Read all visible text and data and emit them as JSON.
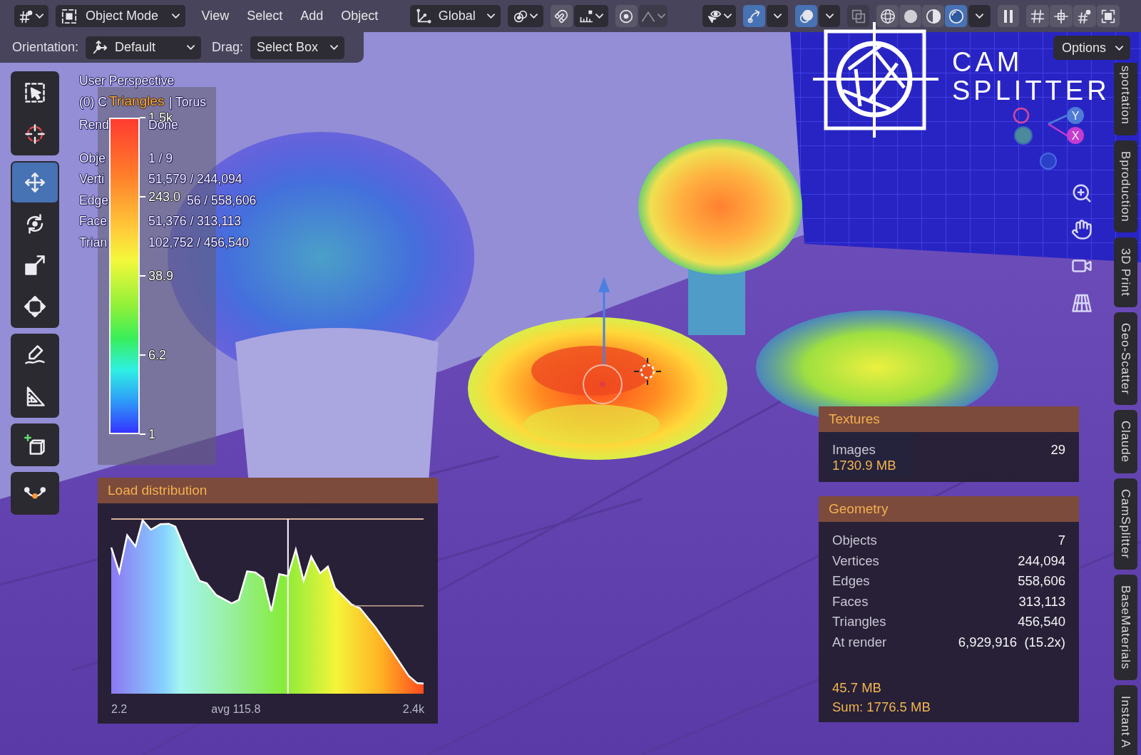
{
  "header": {
    "mode": {
      "label": "Object Mode"
    },
    "menus": [
      {
        "label": "View"
      },
      {
        "label": "Select"
      },
      {
        "label": "Add"
      },
      {
        "label": "Object"
      }
    ],
    "transform_orientation": {
      "label": "Global"
    },
    "snapping": {
      "on": false
    },
    "proportional_editing": {
      "on": false
    },
    "gizmos": {
      "on": true
    },
    "overlays": {
      "on": true
    },
    "xray": {
      "on": false
    },
    "shading": [
      {
        "kind": "wireframe",
        "selected": false
      },
      {
        "kind": "solid",
        "selected": false
      },
      {
        "kind": "material",
        "selected": false
      },
      {
        "kind": "rendered",
        "selected": true
      }
    ]
  },
  "tool_settings": {
    "orientation_label": "Orientation:",
    "orientation": {
      "value": "Default"
    },
    "drag_label": "Drag:",
    "drag": {
      "value": "Select Box"
    },
    "options": {
      "label": "Options"
    }
  },
  "toolbar": [
    {
      "tools": [
        {
          "kind": "select_box",
          "selected": false
        },
        {
          "kind": "cursor",
          "selected": false
        }
      ]
    },
    {
      "tools": [
        {
          "kind": "move",
          "selected": true
        },
        {
          "kind": "rotate",
          "selected": false
        },
        {
          "kind": "scale",
          "selected": false
        },
        {
          "kind": "transform",
          "selected": false
        }
      ]
    },
    {
      "tools": [
        {
          "kind": "annotate",
          "selected": false
        },
        {
          "kind": "measure",
          "selected": false
        }
      ]
    },
    {
      "tools": [
        {
          "kind": "add_cube",
          "selected": false
        }
      ]
    },
    {
      "tools": [
        {
          "kind": "curve",
          "selected": false
        }
      ]
    }
  ],
  "viewport_info": {
    "view": "User Perspective",
    "collection_start": "(0) C",
    "collection_end": "| Torus",
    "render_start": "Rend",
    "render_end": "Done",
    "stats": [
      {
        "kind": "clear",
        "label": "Obje",
        "value": "1 / 9"
      },
      {
        "kind": "clear",
        "label": "Verti",
        "value": "51,579 / 244,094"
      },
      {
        "kind": "covered",
        "label": "Edge",
        "value": "56 / 558,606"
      },
      {
        "kind": "clear",
        "label": "Face",
        "value": "51,376 / 313,113"
      },
      {
        "kind": "clear",
        "label": "Trian",
        "value": "102,752 / 456,540"
      }
    ]
  },
  "legend": {
    "title": "Triangles",
    "ticks": [
      "1.5k",
      "243.0",
      "38.9",
      "6.2",
      "1"
    ]
  },
  "load_distribution": {
    "title": "Load distribution",
    "min_label": "2.2",
    "avg_label": "avg 115.8",
    "max_label": "2.4k"
  },
  "textures": {
    "title": "Textures",
    "rows": [
      {
        "label": "Images",
        "value": "29"
      }
    ],
    "size": "1730.9 MB"
  },
  "geometry": {
    "title": "Geometry",
    "rows": [
      {
        "label": "Objects",
        "value": "7"
      },
      {
        "label": "Vertices",
        "value": "244,094"
      },
      {
        "label": "Edges",
        "value": "558,606"
      },
      {
        "label": "Faces",
        "value": "313,113"
      },
      {
        "label": "Triangles",
        "value": "456,540"
      },
      {
        "label": "At render",
        "value": "6,929,916  (15.2x)"
      }
    ],
    "size": "45.7 MB",
    "sum": "Sum: 1776.5 MB"
  },
  "navigation_gizmo": {
    "axes": [
      {
        "label": "Y",
        "color": "#4d7bd8"
      },
      {
        "label": "X",
        "color": "#c33ccf"
      }
    ]
  },
  "logo": {
    "lines": [
      "CAM",
      "SPLITTER"
    ]
  },
  "sidebar_tabs": [
    {
      "label": "sportation",
      "selected": false
    },
    {
      "label": "Bproduction",
      "selected": false
    },
    {
      "label": "3D Print",
      "selected": false
    },
    {
      "label": "Geo-Scatter",
      "selected": false
    },
    {
      "label": "Claude",
      "selected": false
    },
    {
      "label": "CamSplitter",
      "selected": false
    },
    {
      "label": "BaseMaterials",
      "selected": false
    },
    {
      "label": "Instant A",
      "selected": false
    }
  ]
}
